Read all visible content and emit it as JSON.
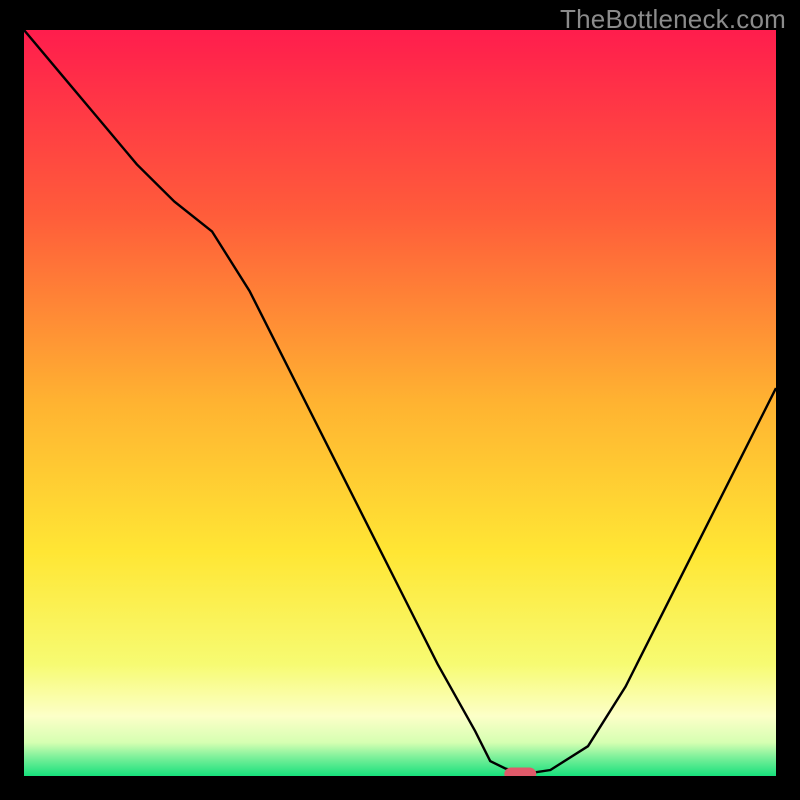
{
  "watermark": "TheBottleneck.com",
  "chart_data": {
    "type": "line",
    "title": "",
    "xlabel": "",
    "ylabel": "",
    "xlim": [
      0,
      100
    ],
    "ylim": [
      0,
      100
    ],
    "categories_x": [
      0,
      5,
      10,
      15,
      20,
      25,
      30,
      35,
      40,
      45,
      50,
      55,
      60,
      62,
      64,
      66,
      68,
      70,
      75,
      80,
      85,
      90,
      95,
      100
    ],
    "values_y": [
      100,
      94,
      88,
      82,
      77,
      73,
      65,
      55,
      45,
      35,
      25,
      15,
      6,
      2,
      1,
      0.5,
      0.5,
      0.8,
      4,
      12,
      22,
      32,
      42,
      52
    ],
    "series": [
      {
        "name": "bottleneck-curve",
        "stroke": "#000000"
      }
    ],
    "marker": {
      "x": 66,
      "y": 0.2,
      "color": "#e05a6a"
    },
    "background_gradient": {
      "stops": [
        {
          "offset": 0.0,
          "color": "#ff1d4d"
        },
        {
          "offset": 0.25,
          "color": "#ff5d3a"
        },
        {
          "offset": 0.5,
          "color": "#ffb331"
        },
        {
          "offset": 0.7,
          "color": "#ffe634"
        },
        {
          "offset": 0.85,
          "color": "#f7fb72"
        },
        {
          "offset": 0.92,
          "color": "#fcffc8"
        },
        {
          "offset": 0.955,
          "color": "#d6ffb2"
        },
        {
          "offset": 0.975,
          "color": "#7cf09a"
        },
        {
          "offset": 1.0,
          "color": "#17e07c"
        }
      ]
    }
  }
}
